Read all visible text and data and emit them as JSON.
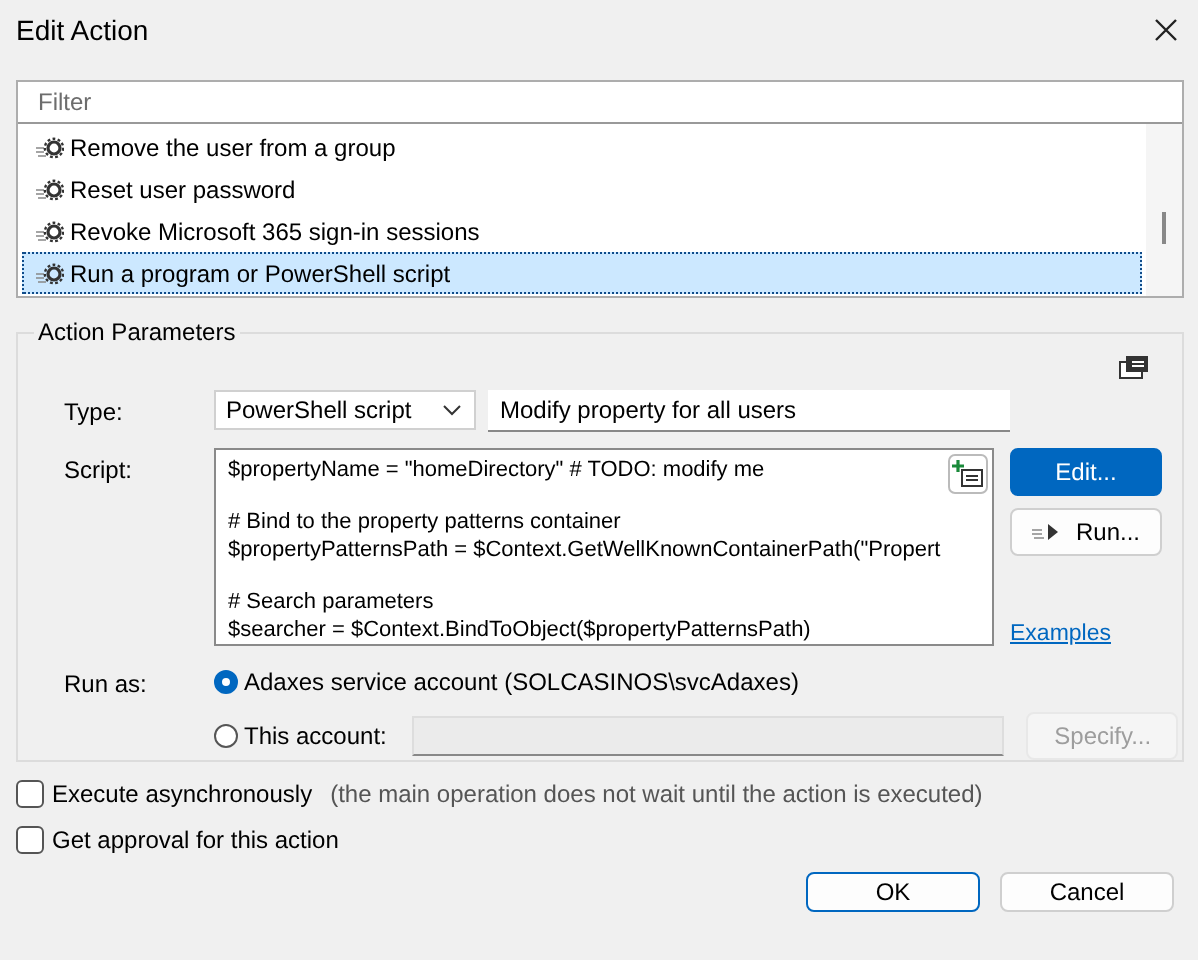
{
  "window": {
    "title": "Edit Action"
  },
  "actions": {
    "filter_placeholder": "Filter",
    "items": [
      {
        "label": "Remove the user from a group",
        "selected": false
      },
      {
        "label": "Reset user password",
        "selected": false
      },
      {
        "label": "Revoke Microsoft 365 sign-in sessions",
        "selected": false
      },
      {
        "label": "Run a program or PowerShell script",
        "selected": true
      }
    ]
  },
  "parameters": {
    "title": "Action Parameters",
    "type_label": "Type:",
    "type_value": "PowerShell script",
    "description": "Modify property for all users",
    "script_label": "Script:",
    "script_blocks": [
      [
        "$propertyName = \"homeDirectory\" # TODO: modify me"
      ],
      [
        "# Bind to the property patterns container",
        "$propertyPatternsPath = $Context.GetWellKnownContainerPath(\"Propert"
      ],
      [
        "# Search parameters",
        "$searcher = $Context.BindToObject($propertyPatternsPath)"
      ]
    ],
    "edit_button": "Edit...",
    "run_button": "Run...",
    "examples_link": "Examples",
    "run_as_label": "Run as:",
    "run_as": [
      {
        "label": "Adaxes service account (SOLCASINOS\\svcAdaxes)",
        "selected": true,
        "kind": "plain"
      },
      {
        "label": "This account:",
        "selected": false,
        "kind": "account"
      }
    ],
    "specify_button": "Specify..."
  },
  "options": [
    {
      "label": "Execute asynchronously",
      "note": "(the main operation does not wait until the action is executed)",
      "checked": false
    },
    {
      "label": "Get approval for this action",
      "checked": false
    }
  ],
  "buttons": [
    {
      "label": "OK",
      "kind": "default"
    },
    {
      "label": "Cancel",
      "kind": "normal"
    }
  ]
}
